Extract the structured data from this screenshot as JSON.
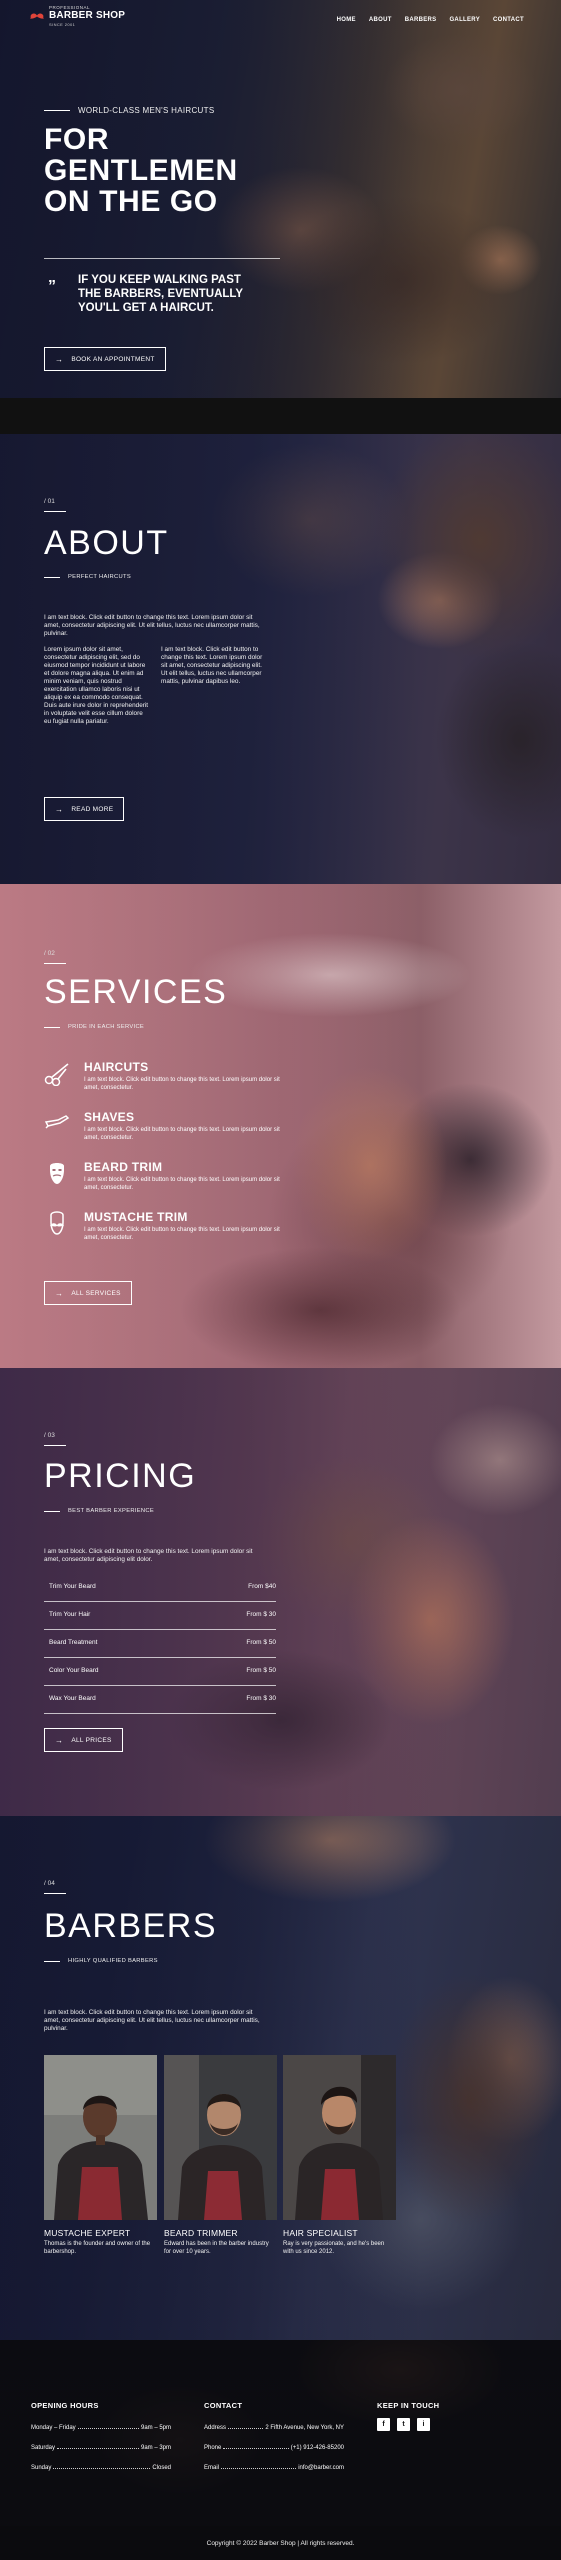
{
  "header": {
    "logo_small": "PROFESSIONAL",
    "logo_big": "BARBER SHOP",
    "logo_since": "SINCE 2001",
    "nav": [
      "HOME",
      "ABOUT",
      "BARBERS",
      "GALLERY",
      "CONTACT"
    ]
  },
  "hero": {
    "eyebrow": "WORLD-CLASS MEN'S HAIRCUTS",
    "title_lines": [
      "FOR",
      "GENTLEMEN",
      "ON THE GO"
    ],
    "quote_mark": "”",
    "quote_lines": [
      "IF YOU KEEP WALKING PAST",
      "THE BARBERS, EVENTUALLY",
      "YOU'LL GET A HAIRCUT."
    ],
    "button": "BOOK AN APPOINTMENT",
    "button_arrow": "→"
  },
  "about": {
    "number": "/ 01",
    "title": "ABOUT",
    "subtitle": "PERFECT HAIRCUTS",
    "intro": "I am text block. Click edit button to change this text. Lorem ipsum dolor sit amet, consectetur adipiscing elit. Ut elit tellus, luctus nec ullamcorper mattis, pulvinar.",
    "col1": "Lorem ipsum dolor sit amet, consectetur adipiscing elit, sed do eiusmod tempor incididunt ut labore et dolore magna aliqua. Ut enim ad minim veniam, quis nostrud exercitation ullamco laboris nisi ut aliquip ex ea commodo consequat. Duis aute irure dolor in reprehenderit in voluptate velit esse cillum dolore eu fugiat nulla pariatur.",
    "col2": "I am text block. Click edit button to change this text. Lorem ipsum dolor sit amet, consectetur adipiscing elit. Ut elit tellus, luctus nec ullamcorper mattis, pulvinar dapibus leo.",
    "button": "READ MORE"
  },
  "services": {
    "number": "/ 02",
    "title": "SERVICES",
    "subtitle": "PRIDE IN EACH SERVICE",
    "items": [
      {
        "title": "HAIRCUTS",
        "icon": "scissors-icon",
        "text": "I am text block. Click edit button to change this text. Lorem ipsum dolor sit amet, consectetur."
      },
      {
        "title": "SHAVES",
        "icon": "razor-icon",
        "text": "I am text block. Click edit button to change this text. Lorem ipsum dolor sit amet, consectetur."
      },
      {
        "title": "BEARD TRIM",
        "icon": "beard-icon",
        "text": "I am text block. Click edit button to change this text. Lorem ipsum dolor sit amet, consectetur."
      },
      {
        "title": "MUSTACHE TRIM",
        "icon": "mustache-icon",
        "text": "I am text block. Click edit button to change this text. Lorem ipsum dolor sit amet, consectetur."
      }
    ],
    "button": "ALL SERVICES"
  },
  "pricing": {
    "number": "/ 03",
    "title": "PRICING",
    "subtitle": "BEST BARBER EXPERIENCE",
    "intro": "I am text block. Click edit button to change this text. Lorem ipsum dolor sit amet, consectetur adipiscing elit dolor.",
    "rows": [
      {
        "name": "Trim Your Beard",
        "price": "From $40"
      },
      {
        "name": "Trim Your Hair",
        "price": "From $ 30"
      },
      {
        "name": "Beard Treatment",
        "price": "From $ 50"
      },
      {
        "name": "Color Your Beard",
        "price": "From $ 50"
      },
      {
        "name": "Wax Your Beard",
        "price": "From $ 30"
      }
    ],
    "button": "ALL PRICES"
  },
  "barbers": {
    "number": "/ 04",
    "title": "BARBERS",
    "subtitle": "HIGHLY QUALIFIED BARBERS",
    "intro": "I am text block. Click edit button to change this text. Lorem ipsum dolor sit amet, consectetur adipiscing elit. Ut elit tellus, luctus nec ullamcorper mattis, pulvinar.",
    "members": [
      {
        "role": "MUSTACHE EXPERT",
        "desc": "Thomas is the founder and owner of the barbershop."
      },
      {
        "role": "BEARD TRIMMER",
        "desc": "Edward has been in the barber industry for over 10 years."
      },
      {
        "role": "HAIR SPECIALIST",
        "desc": "Ray is very passionate, and he's been with us since 2012."
      }
    ]
  },
  "footer": {
    "hours_title": "OPENING HOURS",
    "hours": [
      {
        "label": "Monday – Friday",
        "value": "9am – 5pm"
      },
      {
        "label": "Saturday",
        "value": "9am – 3pm"
      },
      {
        "label": "Sunday",
        "value": "Closed"
      }
    ],
    "contact_title": "CONTACT",
    "contact": [
      {
        "label": "Address",
        "value": "2 Fifth Avenue, New York, NY"
      },
      {
        "label": "Phone",
        "value": "(+1) 912-426-85200"
      },
      {
        "label": "Email",
        "value": "info@barber.com"
      }
    ],
    "social_title": "KEEP IN TOUCH",
    "social": [
      "f",
      "t",
      "i"
    ],
    "copyright": "Copyright © 2022 Barber Shop | All rights reserved."
  }
}
